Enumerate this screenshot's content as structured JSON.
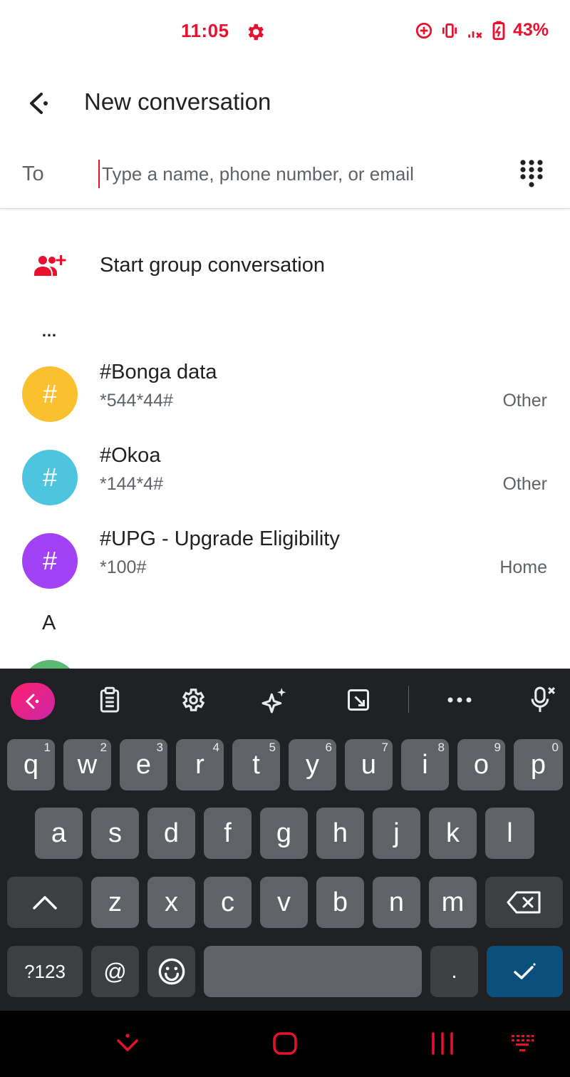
{
  "status_bar": {
    "time": "11:05",
    "battery": "43%",
    "accent_color": "#e8112d"
  },
  "app_bar": {
    "title": "New conversation"
  },
  "to_field": {
    "label": "To",
    "placeholder": "Type a name, phone number, or email",
    "value": ""
  },
  "group": {
    "label": "Start group conversation"
  },
  "section_header": "…",
  "contacts": [
    {
      "avatar_text": "#",
      "name": "#Bonga data",
      "number": "*544*44#",
      "type": "Other",
      "color": "#fbc02d"
    },
    {
      "avatar_text": "#",
      "name": "#Okoa",
      "number": "*144*4#",
      "type": "Other",
      "color": "#4ec5df"
    },
    {
      "avatar_text": "#",
      "name": "#UPG - Upgrade Eligibility",
      "number": "*100#",
      "type": "Home",
      "color": "#a142f4"
    }
  ],
  "section_letter": "A",
  "keyboard": {
    "row1": [
      {
        "label": "q",
        "hint": "1"
      },
      {
        "label": "w",
        "hint": "2"
      },
      {
        "label": "e",
        "hint": "3"
      },
      {
        "label": "r",
        "hint": "4"
      },
      {
        "label": "t",
        "hint": "5"
      },
      {
        "label": "y",
        "hint": "6"
      },
      {
        "label": "u",
        "hint": "7"
      },
      {
        "label": "i",
        "hint": "8"
      },
      {
        "label": "o",
        "hint": "9"
      },
      {
        "label": "p",
        "hint": "0"
      }
    ],
    "row2": [
      "a",
      "s",
      "d",
      "f",
      "g",
      "h",
      "j",
      "k",
      "l"
    ],
    "row3": [
      "z",
      "x",
      "c",
      "v",
      "b",
      "n",
      "m"
    ],
    "symbols_label": "?123",
    "at_label": "@",
    "period_label": "."
  }
}
